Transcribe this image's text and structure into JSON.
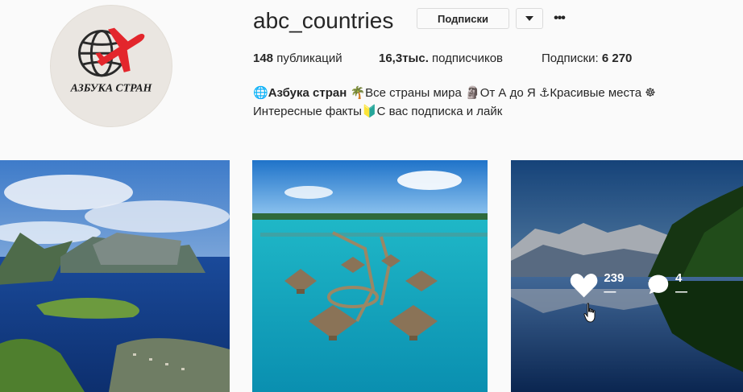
{
  "profile": {
    "username": "abc_countries",
    "avatar_text": "АЗБУКА СТРАН",
    "follow_label": "Подписки",
    "more_icon": "more-dots-icon"
  },
  "stats": {
    "posts_value": "148",
    "posts_label": "публикаций",
    "followers_value": "16,3тыс.",
    "followers_label": "подписчиков",
    "following_label": "Подписки:",
    "following_value": "6 270"
  },
  "bio": {
    "line1_name": "Азбука стран",
    "line1_part1": "Все страны мира",
    "line1_part2": "От А до Я",
    "line1_part3": "Красивые места",
    "line2_part1": "Интересные факты",
    "line2_part2": "С вас подписка и лайк"
  },
  "posts": [
    {
      "alt": "fjord landscape"
    },
    {
      "alt": "overwater bungalows"
    },
    {
      "alt": "mountain lake reflection",
      "likes": "239 —",
      "comments": "4 —"
    }
  ],
  "colors": {
    "text": "#262626",
    "border": "#dbdbdb",
    "logo_red": "#e3262c"
  }
}
